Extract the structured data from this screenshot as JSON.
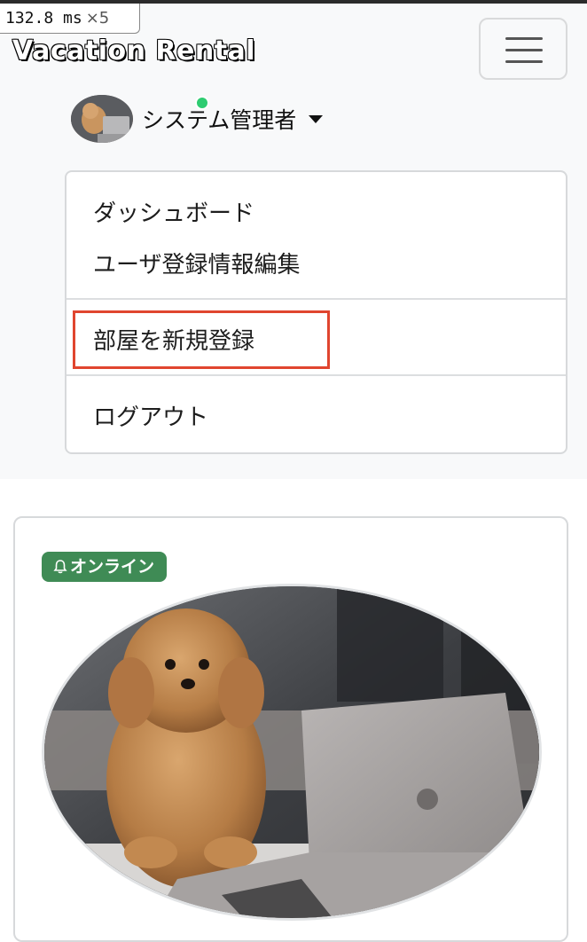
{
  "perf": {
    "time": "132.8 ms",
    "multiplier": "×5"
  },
  "navbar": {
    "brand": "Vacation Rental",
    "toggler_icon": "hamburger-icon",
    "user": {
      "name": "システム管理者",
      "status_color": "#2ecc71",
      "caret_icon": "caret-down-icon"
    }
  },
  "dropdown": {
    "items": [
      {
        "label": "ダッシュボード"
      },
      {
        "label": "ユーザ登録情報編集"
      },
      {
        "label": "部屋を新規登録"
      },
      {
        "label": "ログアウト"
      }
    ],
    "highlight_color": "#e0452f"
  },
  "card": {
    "badge": {
      "label": "オンライン",
      "icon": "bell-icon",
      "color": "#3f8b55"
    }
  }
}
